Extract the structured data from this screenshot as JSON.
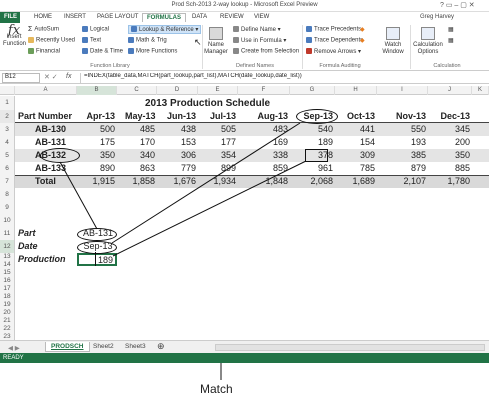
{
  "window": {
    "title": "Prod Sch-2013 2-way lookup - Microsoft Excel Preview",
    "user": "Greg Harvey"
  },
  "tabs": [
    "FILE",
    "HOME",
    "INSERT",
    "PAGE LAYOUT",
    "FORMULAS",
    "DATA",
    "REVIEW",
    "VIEW"
  ],
  "active_tab": "FORMULAS",
  "ribbon": {
    "insert_function": "Insert Function",
    "autosum": "AutoSum",
    "recently_used": "Recently Used",
    "financial": "Financial",
    "logical": "Logical",
    "text": "Text",
    "date_time": "Date & Time",
    "lookup_reference": "Lookup & Reference",
    "math_trig": "Math & Trig",
    "more_functions": "More Functions",
    "function_library": "Function Library",
    "name_manager": "Name Manager",
    "define_name": "Define Name",
    "use_in_formula": "Use in Formula",
    "create_from_selection": "Create from Selection",
    "defined_names": "Defined Names",
    "trace_precedents": "Trace Precedents",
    "trace_dependents": "Trace Dependents",
    "remove_arrows": "Remove Arrows",
    "formula_auditing": "Formula Auditing",
    "watch_window": "Watch Window",
    "calc_options": "Calculation Options",
    "calculation": "Calculation"
  },
  "namebox": "B12",
  "fx": "fx",
  "formula": "=INDEX(table_data,MATCH(part_lookup,part_list),MATCH(date_lookup,date_list))",
  "columns": [
    "A",
    "B",
    "C",
    "D",
    "E",
    "F",
    "G",
    "H",
    "I",
    "J",
    "K"
  ],
  "rows": [
    "1",
    "2",
    "3",
    "4",
    "5",
    "6",
    "7",
    "8",
    "9",
    "10",
    "11",
    "12",
    "13",
    "14",
    "15",
    "16",
    "17",
    "18",
    "19",
    "20",
    "21",
    "22",
    "23"
  ],
  "sheet_title": "2013 Production Schedule",
  "table": {
    "headers": [
      "Part Number",
      "Apr-13",
      "May-13",
      "Jun-13",
      "Jul-13",
      "Aug-13",
      "Sep-13",
      "Oct-13",
      "Nov-13",
      "Dec-13"
    ],
    "rows": [
      [
        "AB-130",
        "500",
        "485",
        "438",
        "505",
        "483",
        "540",
        "441",
        "550",
        "345"
      ],
      [
        "AB-131",
        "175",
        "170",
        "153",
        "177",
        "169",
        "189",
        "154",
        "193",
        "200"
      ],
      [
        "AB-132",
        "350",
        "340",
        "306",
        "354",
        "338",
        "378",
        "309",
        "385",
        "350"
      ],
      [
        "AB-133",
        "890",
        "863",
        "779",
        "899",
        "859",
        "961",
        "785",
        "879",
        "885"
      ]
    ],
    "total": [
      "Total",
      "1,915",
      "1,858",
      "1,676",
      "1,934",
      "1,848",
      "2,068",
      "1,689",
      "2,107",
      "1,780"
    ]
  },
  "lookup": {
    "part_label": "Part",
    "part_value": "AB-131",
    "date_label": "Date",
    "date_value": "Sep-13",
    "prod_label": "Production",
    "prod_value": "189"
  },
  "sheets": [
    "PRODSCH",
    "Sheet2",
    "Sheet3"
  ],
  "status": "READY",
  "callout": "Match"
}
